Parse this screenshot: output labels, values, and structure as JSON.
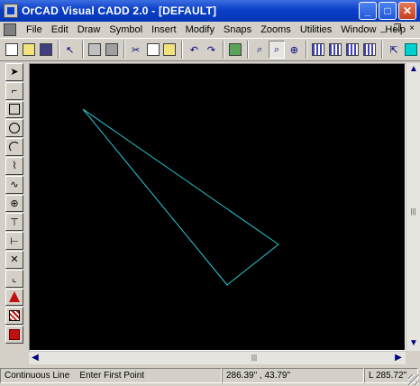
{
  "window": {
    "title": "OrCAD Visual CADD 2.0 - [DEFAULT]"
  },
  "title_buttons": {
    "minimize": "_",
    "maximize": "□",
    "close": "✕"
  },
  "menu": {
    "items": [
      "File",
      "Edit",
      "Draw",
      "Symbol",
      "Insert",
      "Modify",
      "Snaps",
      "Zooms",
      "Utilities",
      "Window",
      "Help"
    ],
    "mdi": {
      "minimize": "_",
      "restore": "❐",
      "close": "×"
    }
  },
  "toolbar": {
    "buttons": [
      {
        "name": "new-icon"
      },
      {
        "name": "open-icon"
      },
      {
        "name": "save-icon"
      },
      {
        "name": "select-icon"
      },
      {
        "name": "print-icon"
      },
      {
        "name": "print-preview-icon"
      },
      {
        "name": "cut-icon"
      },
      {
        "name": "copy-icon"
      },
      {
        "name": "paste-icon"
      },
      {
        "name": "undo-icon"
      },
      {
        "name": "redo-icon"
      },
      {
        "name": "layers-icon"
      },
      {
        "name": "zoom-window-icon"
      },
      {
        "name": "zoom-all-icon"
      },
      {
        "name": "zoom-in-icon"
      },
      {
        "name": "grid-icon"
      },
      {
        "name": "ortho-icon"
      },
      {
        "name": "snap-icon"
      },
      {
        "name": "properties-icon"
      },
      {
        "name": "help-icon"
      },
      {
        "name": "color-icon"
      }
    ]
  },
  "left_tools": [
    "pointer-icon",
    "line-icon",
    "rectangle-icon",
    "circle-icon",
    "arc-icon",
    "polyline-icon",
    "curve-icon",
    "point-icon",
    "dimension-icon",
    "text-icon",
    "hatch-icon",
    "trim-icon",
    "fillet-icon",
    "symbol-icon",
    "fill-icon"
  ],
  "drawing": {
    "line_color": "#28c8d8",
    "background": "#000000"
  },
  "scrollbars": {
    "up": "▲",
    "down": "▼",
    "left": "◀",
    "right": "▶",
    "thumb": "|||"
  },
  "status": {
    "line_type": "Continuous Line",
    "prompt": "Enter First Point",
    "coords": "286.39\" , 43.79\"",
    "length": "L 285.72\""
  }
}
